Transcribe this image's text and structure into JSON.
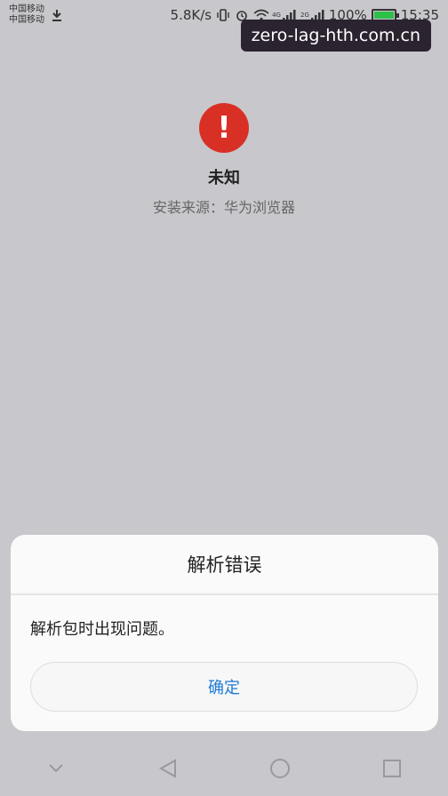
{
  "status_bar": {
    "carrier_1": "中国移动",
    "carrier_2": "中国移动",
    "speed": "5.8K/s",
    "network_1": "4G",
    "network_2": "2G",
    "battery": "100%",
    "time": "15:35",
    "icons": [
      "download-icon",
      "vibrate-icon",
      "alarm-icon",
      "wifi-icon",
      "signal-icon",
      "signal-icon",
      "battery-icon"
    ]
  },
  "watermark": "zero-lag-hth.com.cn",
  "app": {
    "name": "未知",
    "install_source": "安装来源：华为浏览器",
    "icon": "error-icon",
    "icon_glyph": "!"
  },
  "dialog": {
    "title": "解析错误",
    "message": "解析包时出现问题。",
    "confirm_label": "确定"
  },
  "nav_bar": {
    "icons": [
      "chevron-down-icon",
      "back-icon",
      "home-icon",
      "recent-apps-icon"
    ]
  },
  "colors": {
    "background": "#c8c7cb",
    "error": "#d93025",
    "accent": "#1f7ad6",
    "battery": "#2dbf4a"
  }
}
